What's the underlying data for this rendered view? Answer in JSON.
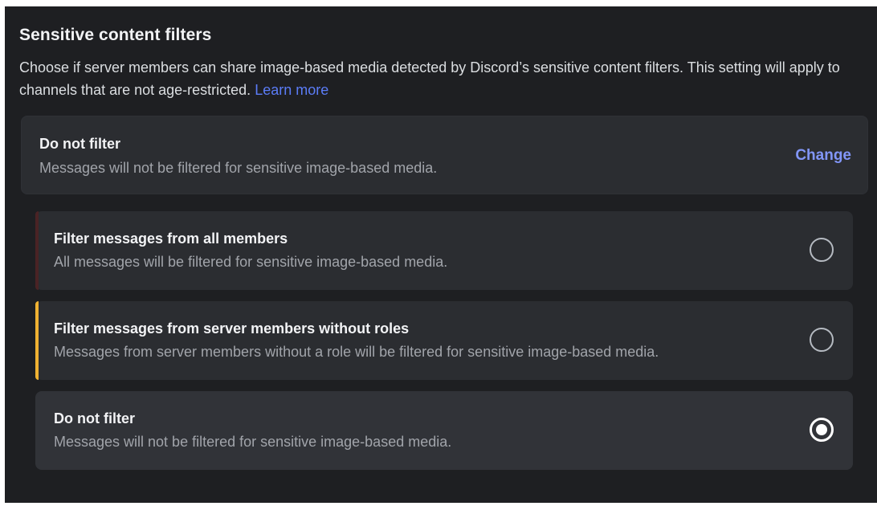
{
  "section": {
    "title": "Sensitive content filters",
    "description": "Choose if server members can share image-based media detected by Discord’s sensitive content filters. This setting will apply to channels that are not age-restricted.",
    "learn_more_label": "Learn more"
  },
  "current_setting": {
    "title": "Do not filter",
    "subtitle": "Messages will not be filtered for sensitive image-based media.",
    "change_label": "Change"
  },
  "options": [
    {
      "title": "Filter messages from all members",
      "subtitle": "All messages will be filtered for sensitive image-based media.",
      "accent_color": "#4a2325",
      "selected": false
    },
    {
      "title": "Filter messages from server members without roles",
      "subtitle": "Messages from server members without a role will be filtered for sensitive image-based media.",
      "accent_color": "#f0b232",
      "selected": false
    },
    {
      "title": "Do not filter",
      "subtitle": "Messages will not be filtered for sensitive image-based media.",
      "accent_color": "",
      "selected": true
    }
  ],
  "colors": {
    "background": "#1e1f22",
    "card": "#2b2d31",
    "link": "#5b7cf7",
    "warning_accent": "#f0b232"
  }
}
